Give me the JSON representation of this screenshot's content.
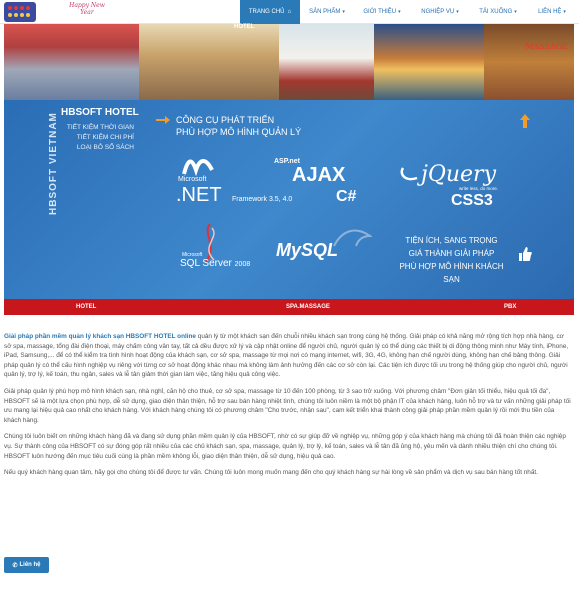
{
  "header": {
    "logo_text": "Happy New Year",
    "nav": [
      {
        "label": "TRANG CHỦ",
        "icon": "home-icon",
        "active": true
      },
      {
        "label": "SẢN PHẨM",
        "caret": true
      },
      {
        "label": "GIỚI THIỆU",
        "caret": true
      },
      {
        "label": "NGHIỆP VỤ",
        "caret": true
      },
      {
        "label": "TẢI XUỐNG",
        "caret": true
      },
      {
        "label": "LIÊN HỆ",
        "caret": true
      }
    ]
  },
  "banner": {
    "hotel_sign": "HOTEL",
    "massage_sign": "MASSAGE"
  },
  "promo": {
    "title": "HBSOFT HOTEL",
    "vertical_title": "HBSOFT VIETNAM",
    "taglines": [
      "TIẾT KIỆM THỜI GIAN",
      "TIẾT KIỆM CHI PHÍ",
      "LOẠI BỎ SỔ SÁCH"
    ],
    "headline": [
      "CÔNG CỤ PHÁT TRIỂN",
      "PHÙ HỢP MÔ HÌNH QUẢN LÝ"
    ],
    "net": {
      "brand": "Microsoft",
      "name": ".NET",
      "framework": "Framework 3.5, 4.0"
    },
    "ajax": {
      "prefix": "ASP.net",
      "name": "AJAX",
      "cs": "C#"
    },
    "jquery": {
      "name": "jQuery",
      "slogan": "write less, do more.",
      "css": "CSS3"
    },
    "sql": {
      "brand": "Microsoft",
      "name": "SQL Server",
      "year": "2008"
    },
    "mysql": "MySQL",
    "benefits": [
      "TIỆN ÍCH, SANG TRỌNG",
      "GIÁ THÀNH GIẢI PHÁP",
      "PHÙ HỢP MÔ HÌNH KHÁCH SẠN"
    ]
  },
  "redbar": [
    "HOTEL",
    "SPA.MASSAGE",
    "PBX"
  ],
  "content": {
    "p1_highlight": "Giải pháp phần mềm quản lý khách sạn HBSOFT HOTEL online",
    "p1_rest": " quản lý từ một khách sạn đến chuỗi nhiều khách sạn trong cùng hệ thống. Giải pháp có khả năng mở rộng tích hợp nhà hàng, cơ sở spa, massage, tổng đài điện thoại, máy chấm công vân tay, tất cả dều được xử lý và cập nhật online để người chủ, người quản lý có thể dùng các thiết bị di động thông minh như Máy tính, iPhone, iPad, Samsung,... để có thể kiểm tra tình hình hoạt động của khách sạn, cơ sở spa, massage từ mọi nơi có mạng internet, wifi, 3G, 4G, không hạn chế người dùng, không hạn chế bảng thông. Giải pháp quản lý có thể cấu hình nghiệp vụ riêng với từng cơ sở hoạt động khác nhau mà không làm ảnh hưởng đến các cơ sở còn lại. Các tiện ích được tối ưu trong hệ thống giúp cho người chủ, người quản lý, trợ lý, kế toán, thu ngân, sales và lễ tân giảm thời gian làm việc, tăng hiệu quả công việc.",
    "p2": "Giải pháp quản lý phù hợp mô hình khách sạn, nhà nghỉ, căn hộ cho thuê, cơ sở spa, massage từ 10 đến 100 phòng, từ 3 sao trở xuống. Với phương châm \"Đơn giản tối thiểu, hiệu quả tối đa\", HBSOFT sẽ là một lựa chọn phù hợp, dễ sử dụng, giao diện thân thiện, hỗ trợ sau bán hàng nhiệt tình, chúng tôi luôn niềm là một bộ phận IT của khách hàng, luôn hỗ trợ và tư vấn những giải pháp tối ưu mang lại hiệu quả cao nhất cho khách hàng. Với khách hàng chúng tôi có phương châm \"Cho trước, nhận sau\", cam kết triển khai thành công giải pháp phần mềm quản lý rồi mới thu tiền của khách hàng.",
    "p3": "Chúng tôi luôn biết ơn những khách hàng đã và đang sử dụng phần mềm quản lý của HBSOFT, nhờ có sự giúp đỡ về nghiệp vụ, những góp ý của khách hàng mà chúng tôi đã hoàn thiện các nghiệp vụ. Sự thành công của HBSOFT có sự đóng góp rất nhiều của các chủ khách sạn, spa, massage, quản lý, trợ lý, kế toán, sales và lễ tân đã ủng hộ, yêu mến và dành nhiều thiện chí cho chúng tôi. HBSOFT luôn hướng đến mục tiêu cuối cùng là phần mềm không lỗi, giao diện thân thiện, dễ sử dụng, hiệu quả cao.",
    "p4": "Nếu quý khách hàng quan tâm, hãy gọi cho chúng tôi để được tư vấn. Chúng tôi luôn mong muốn mang đến cho quý khách hàng sự hài lòng về sản phẩm và dịch vụ sau bán hàng tốt nhất."
  },
  "contact_button": "Liên hệ"
}
